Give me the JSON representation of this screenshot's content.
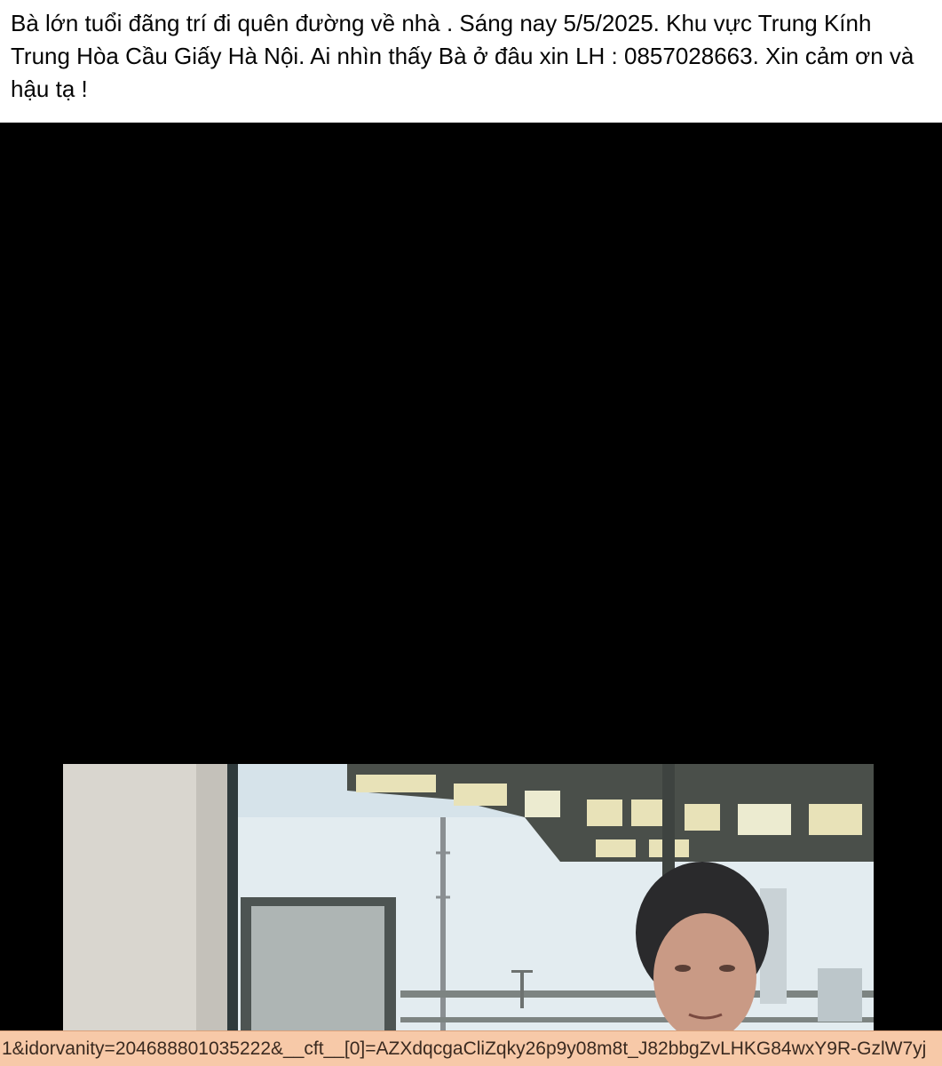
{
  "post": {
    "text": "Bà lớn tuổi đãng trí đi quên đường về nhà . Sáng nay 5/5/2025. Khu vực Trung Kính Trung Hòa Cầu Giấy Hà Nội. Ai nhìn thấy Bà ở đâu xin LH : 0857028663. Xin cảm ơn và hậu tạ !"
  },
  "media": {
    "background_color": "#000000",
    "photo_description_icon": "photo-icon"
  },
  "status_bar": {
    "url": "1&idorvanity=204688801035222&__cft__[0]=AZXdqcgaCliZqky26p9y08m8t_J82bbgZvLHKG84wxY9R-GzlW7yj"
  },
  "colors": {
    "text": "#050505",
    "status_bar_bg": "#f7c9a8"
  }
}
